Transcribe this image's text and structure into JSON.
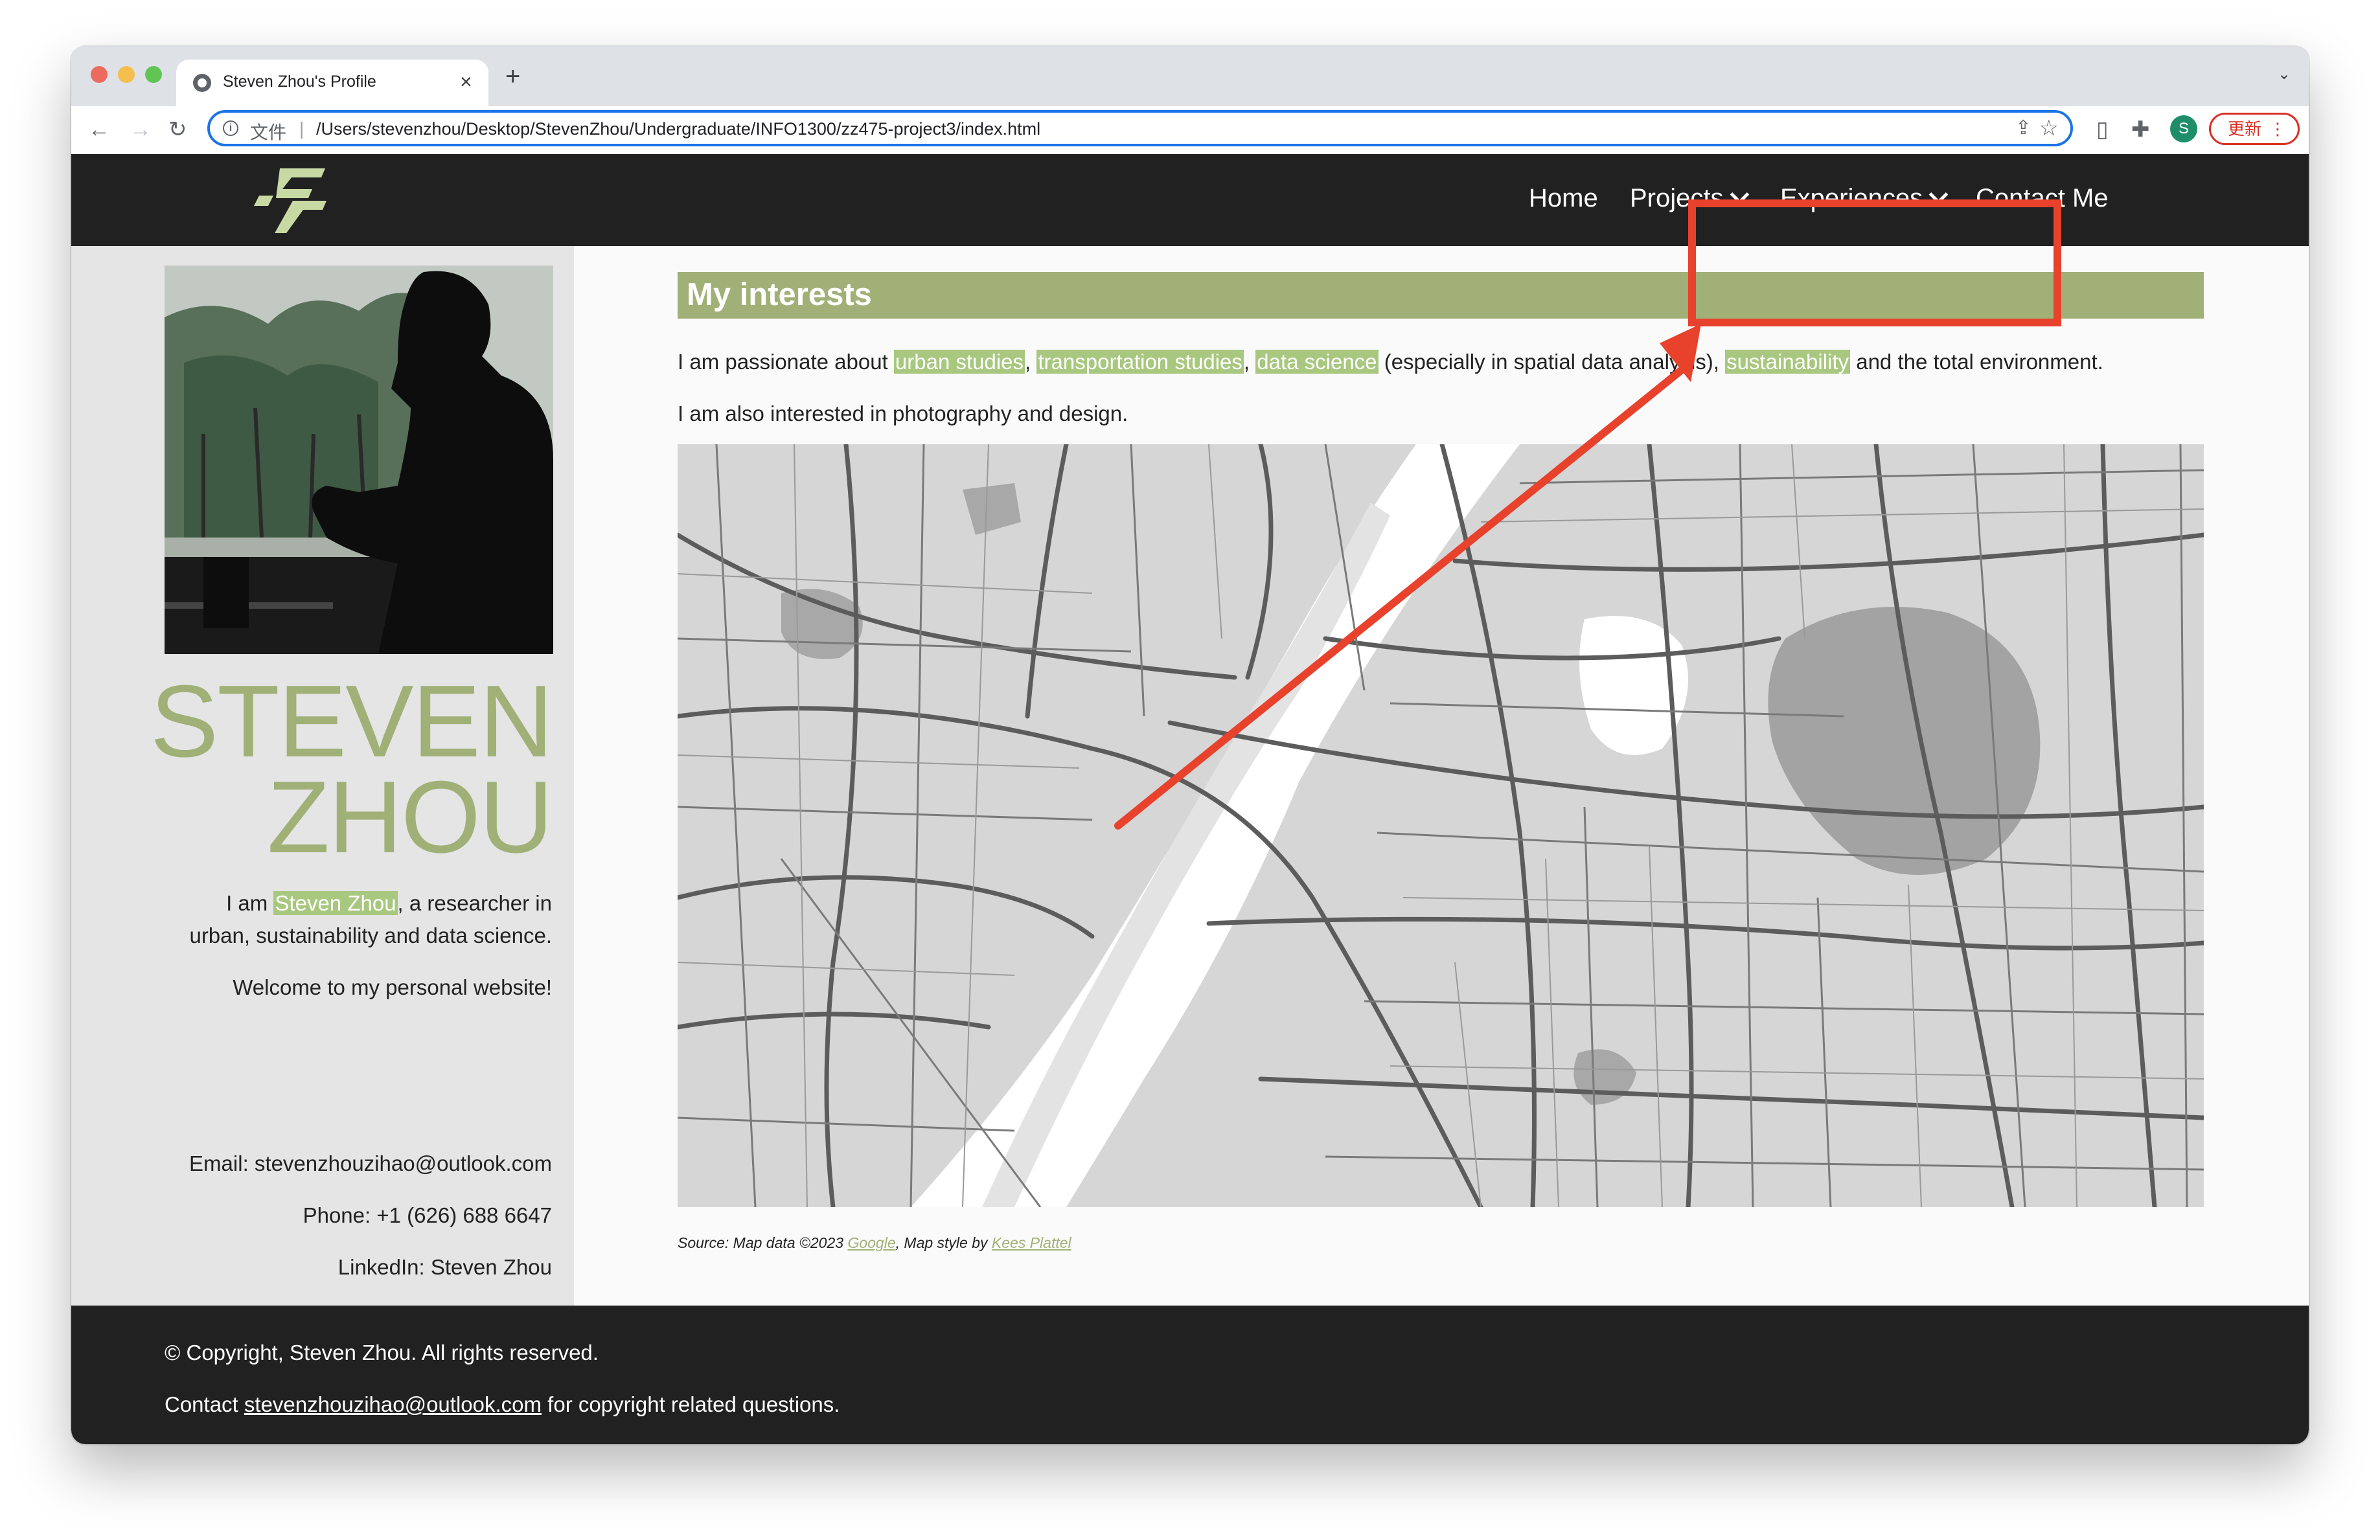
{
  "browser": {
    "tab_title": "Steven Zhou's Profile",
    "tab_close": "×",
    "new_tab": "+",
    "url_scheme": "文件",
    "url": "/Users/stevenzhou/Desktop/StevenZhou/Undergraduate/INFO1300/zz475-project3/index.html",
    "profile_initial": "S",
    "update_label": "更新",
    "icons": [
      "back-icon",
      "forward-icon",
      "reload-icon",
      "info-icon",
      "share-icon",
      "star-icon",
      "document-icon",
      "extensions-icon",
      "sidebar-icon",
      "profile-icon",
      "menu-icon"
    ]
  },
  "site": {
    "nav": {
      "home": "Home",
      "projects": "Projects",
      "experiences": "Experiences",
      "contact": "Contact Me"
    },
    "sidebar": {
      "name_line1": "STEVEN",
      "name_line2": "ZHOU",
      "intro_pre": "I am ",
      "intro_name": "Steven Zhou",
      "intro_post": ", a researcher in",
      "intro_line2": "urban, sustainability and data science.",
      "welcome": "Welcome to my personal website!",
      "email": "Email: stevenzhouzihao@outlook.com",
      "phone": "Phone: +1 (626) 688 6647",
      "linkedin": "LinkedIn: Steven Zhou"
    },
    "main": {
      "section_title": "My interests",
      "p1_pre": "I am passionate about ",
      "tag1": "urban studies",
      "comma1": ", ",
      "tag2": "transportation studies",
      "comma2": ", ",
      "tag3": "data science",
      "p1_mid": " (especially in spatial data analysis), ",
      "tag4": "sustainability",
      "p1_post": " and the total environment.",
      "p2": "I am also interested in photography and design.",
      "source_pre": "Source: Map data ©2023 ",
      "source_google": "Google",
      "source_mid": ", Map style by ",
      "source_style": "Kees Plattel"
    },
    "footer": {
      "copyright": "© Copyright, Steven Zhou. All rights reserved.",
      "contact_pre": "Contact ",
      "contact_email": "stevenzhouzihao@outlook.com",
      "contact_post": " for copyright related questions."
    },
    "colors": {
      "accent": "#a0b077",
      "highlight": "#a8c77f",
      "header_bg": "#212121",
      "sidebar_bg": "#e5e5e5",
      "annotation": "#e8412c"
    }
  }
}
